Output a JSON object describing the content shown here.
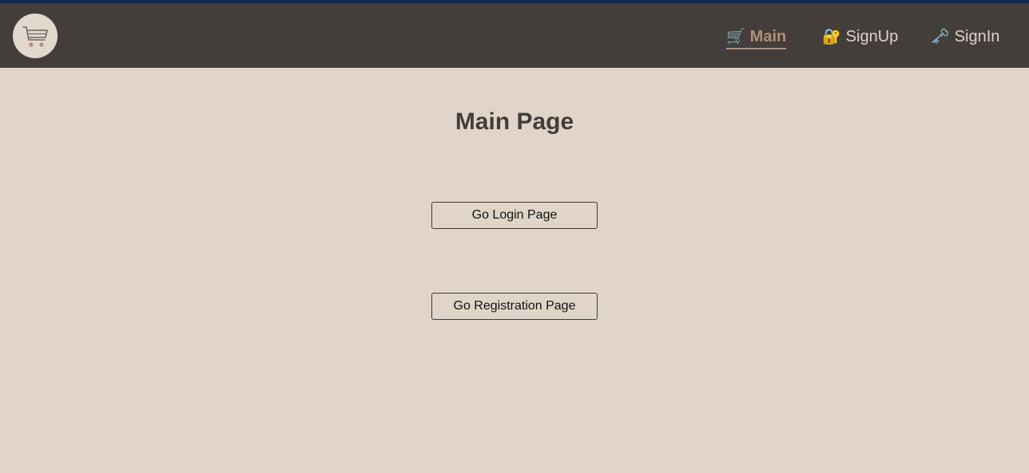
{
  "nav": {
    "logo_icon": "cart-icon",
    "items": [
      {
        "icon": "🛒",
        "icon_name": "cart-icon",
        "label": "Main",
        "active": true
      },
      {
        "icon": "🔐",
        "icon_name": "lock-icon",
        "label": "SignUp",
        "active": false
      },
      {
        "icon": "🗝️",
        "icon_name": "key-icon",
        "label": "SignIn",
        "active": false
      }
    ]
  },
  "main": {
    "title": "Main Page",
    "login_button": "Go Login Page",
    "registration_button": "Go Registration Page"
  },
  "colors": {
    "topline": "#0d2a57",
    "navbar": "#433e3b",
    "background": "#e1d5ca",
    "accent": "#b08f78"
  }
}
